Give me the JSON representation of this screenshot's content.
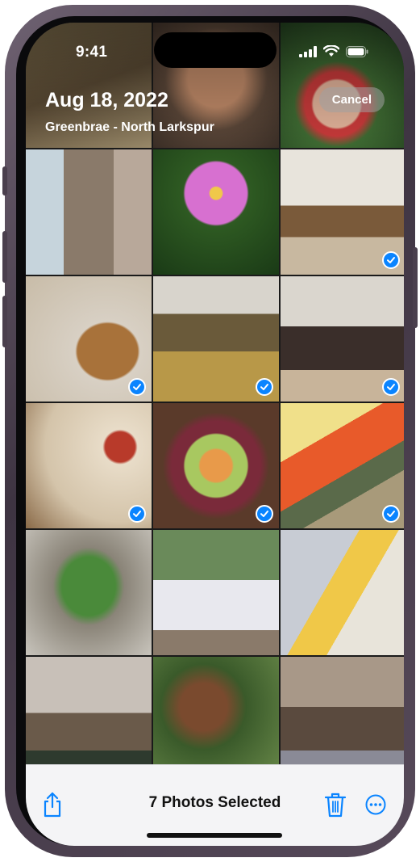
{
  "status_bar": {
    "time": "9:41"
  },
  "header": {
    "date": "Aug 18, 2022",
    "location": "Greenbrae - North Larkspur",
    "cancel_label": "Cancel"
  },
  "photos": [
    {
      "name": "photo-woman-overalls",
      "selected": false
    },
    {
      "name": "photo-woman-smiling-closeup",
      "selected": false
    },
    {
      "name": "photo-strawberry-hand",
      "selected": false
    },
    {
      "name": "photo-woman-white-top",
      "selected": false
    },
    {
      "name": "photo-pink-cosmos-flower",
      "selected": false
    },
    {
      "name": "photo-family-kitchen",
      "selected": true
    },
    {
      "name": "photo-bread-and-oil",
      "selected": true
    },
    {
      "name": "photo-family-posing-kitchen",
      "selected": true
    },
    {
      "name": "photo-woman-apron-kitchen",
      "selected": true
    },
    {
      "name": "photo-appetizers-table",
      "selected": true
    },
    {
      "name": "photo-fruit-bowl",
      "selected": true
    },
    {
      "name": "photo-peppers-cucumbers",
      "selected": true
    },
    {
      "name": "photo-basil-plant",
      "selected": false
    },
    {
      "name": "photo-two-women-outdoors",
      "selected": false
    },
    {
      "name": "photo-woman-and-girl-smiling",
      "selected": false
    },
    {
      "name": "photo-game-room",
      "selected": false
    },
    {
      "name": "photo-woman-and-girl-garden",
      "selected": false
    },
    {
      "name": "photo-family-living-room",
      "selected": false
    }
  ],
  "toolbar": {
    "selection_label": "7 Photos Selected",
    "share_icon": "share-icon",
    "trash_icon": "trash-icon",
    "more_icon": "ellipsis-circle-icon"
  },
  "colors": {
    "accent": "#0a84ff",
    "toolbar_bg": "#f4f4f6"
  }
}
